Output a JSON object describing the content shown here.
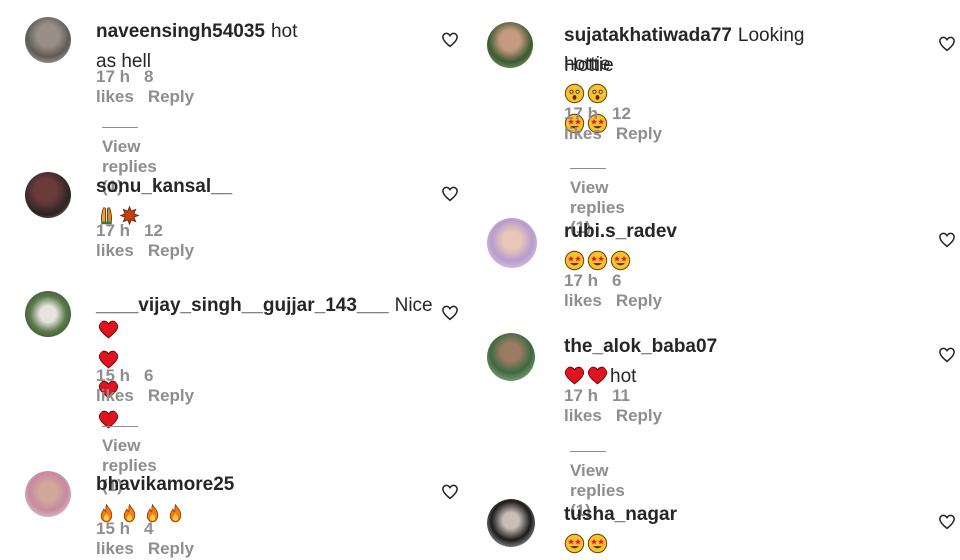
{
  "comments": [
    {
      "username": "naveensingh54035",
      "text": "hot as hell",
      "time": "17 h",
      "likes": "8 likes",
      "reply": "Reply",
      "view_replies": "View replies (1)"
    },
    {
      "username": "sonu_kansal__",
      "text": "",
      "time": "17 h",
      "likes": "12 likes",
      "reply": "Reply"
    },
    {
      "username": "____vijay_singh__gujjar_143___",
      "text": "Nice",
      "time": "15 h",
      "likes": "6 likes",
      "reply": "Reply",
      "view_replies": "View replies (1)"
    },
    {
      "username": "bhavikamore25",
      "text": "",
      "time": "15 h",
      "likes": "4 likes",
      "reply": "Reply"
    },
    {
      "username": "sujatakhatiwada77",
      "text": "Looking Hottie",
      "text2": "hottie",
      "time": "17 h",
      "likes": "12 likes",
      "reply": "Reply",
      "view_replies": "View replies (1)"
    },
    {
      "username": "rubi.s_radev",
      "text": "",
      "time": "17 h",
      "likes": "6 likes",
      "reply": "Reply"
    },
    {
      "username": "the_alok_baba07",
      "text": "hot",
      "time": "17 h",
      "likes": "11 likes",
      "reply": "Reply",
      "view_replies": "View replies (1)"
    },
    {
      "username": "tusha_nagar",
      "text": ""
    }
  ],
  "colors": {
    "text": "#262626",
    "muted": "#8e8e8e",
    "heart_red": "#e0141e",
    "fire": "#f77a14",
    "emoji_yellow": "#f9c12e"
  },
  "icons": {
    "like": "heart-outline-icon",
    "heart_emoji": "red-heart-emoji",
    "fire_emoji": "fire-emoji",
    "star_eyes": "star-struck-emoji",
    "astonished": "astonished-face-emoji"
  }
}
